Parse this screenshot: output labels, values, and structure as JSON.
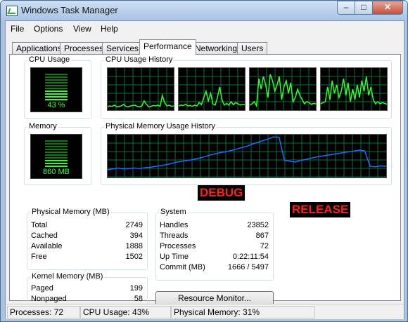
{
  "window": {
    "title": "Windows Task Manager",
    "minimize": "–",
    "maximize": "□",
    "close": "✕"
  },
  "menu": [
    "File",
    "Options",
    "View",
    "Help"
  ],
  "tabs": [
    "Applications",
    "Processes",
    "Services",
    "Performance",
    "Networking",
    "Users"
  ],
  "active_tab": "Performance",
  "cpu_usage": {
    "label": "CPU Usage",
    "value": "43 %",
    "percent": 43
  },
  "cpu_history": {
    "label": "CPU Usage History",
    "cores": [
      [
        8,
        10,
        9,
        12,
        8,
        9,
        10,
        14,
        9,
        8,
        10,
        11,
        12,
        9,
        8,
        10,
        22,
        14,
        8,
        9,
        11,
        10,
        12,
        9,
        35,
        18,
        10,
        12,
        9,
        10
      ],
      [
        10,
        12,
        11,
        14,
        10,
        11,
        9,
        12,
        10,
        18,
        13,
        30,
        45,
        22,
        40,
        15,
        12,
        30,
        55,
        25,
        12,
        16,
        12,
        20,
        13,
        18,
        15,
        12,
        14,
        13
      ],
      [
        12,
        15,
        20,
        10,
        75,
        50,
        80,
        60,
        30,
        85,
        70,
        45,
        60,
        80,
        25,
        55,
        70,
        40,
        65,
        20,
        30,
        50,
        35,
        25,
        15,
        20,
        18,
        14,
        16,
        15
      ],
      [
        15,
        18,
        20,
        55,
        25,
        70,
        40,
        60,
        30,
        45,
        75,
        35,
        65,
        20,
        50,
        25,
        60,
        30,
        70,
        45,
        80,
        35,
        55,
        25,
        15,
        20,
        15,
        18,
        16,
        14
      ]
    ]
  },
  "memory": {
    "label": "Memory",
    "value": "860 MB",
    "percent": 31
  },
  "memory_history": {
    "label": "Physical Memory Usage History",
    "points": [
      18,
      20,
      22,
      20,
      21,
      22,
      21,
      23,
      24,
      26,
      28,
      30,
      33,
      36,
      38,
      40,
      42,
      45,
      48,
      52,
      55,
      58,
      60,
      63,
      66,
      70,
      73,
      78,
      82,
      86,
      90,
      95,
      94,
      40,
      38,
      36,
      40,
      42,
      45,
      48,
      50,
      52,
      54,
      56,
      58,
      60,
      62,
      64,
      62,
      26,
      25,
      27,
      26
    ]
  },
  "annotations": {
    "debug": "DEBUG",
    "release": "RELEASE"
  },
  "physical_memory": {
    "label": "Physical Memory (MB)",
    "rows": [
      {
        "label": "Total",
        "value": "2749"
      },
      {
        "label": "Cached",
        "value": "394"
      },
      {
        "label": "Available",
        "value": "1888"
      },
      {
        "label": "Free",
        "value": "1502"
      }
    ]
  },
  "kernel_memory": {
    "label": "Kernel Memory (MB)",
    "rows": [
      {
        "label": "Paged",
        "value": "199"
      },
      {
        "label": "Nonpaged",
        "value": "58"
      }
    ]
  },
  "system": {
    "label": "System",
    "rows": [
      {
        "label": "Handles",
        "value": "23852"
      },
      {
        "label": "Threads",
        "value": "867"
      },
      {
        "label": "Processes",
        "value": "72"
      },
      {
        "label": "Up Time",
        "value": "0:22:11:54"
      },
      {
        "label": "Commit (MB)",
        "value": "1666 / 5497"
      }
    ]
  },
  "resource_monitor_button": "Resource Monitor...",
  "status": {
    "processes": "Processes: 72",
    "cpu": "CPU Usage: 43%",
    "memory": "Physical Memory: 31%"
  },
  "colors": {
    "graph_grid": "#0a6e3a",
    "graph_line": "#2fff2f",
    "memory_line": "#1e6bff",
    "annotation": "#ff2020"
  }
}
